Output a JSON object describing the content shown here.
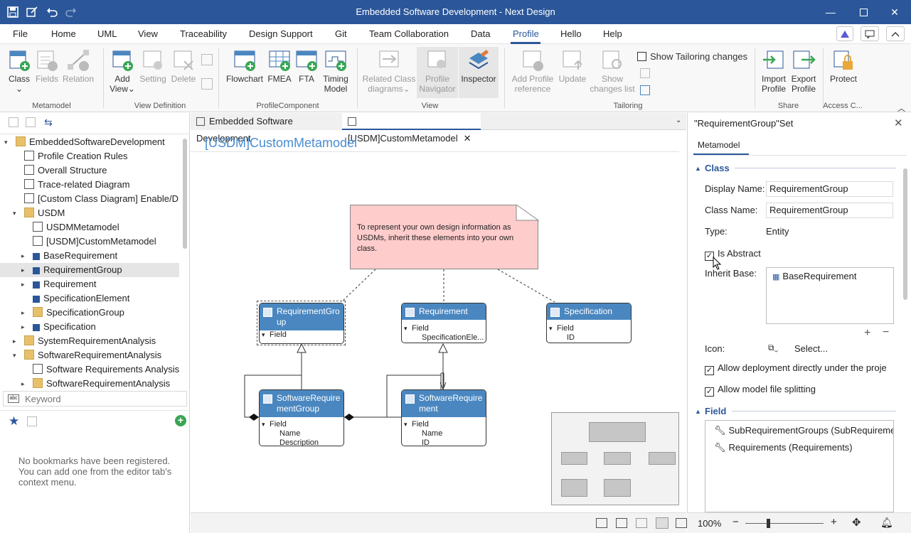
{
  "titlebar": {
    "title": "Embedded Software Development - Next Design"
  },
  "menu": [
    "File",
    "Home",
    "UML",
    "View",
    "Traceability",
    "Design Support",
    "Git",
    "Team Collaboration",
    "Data",
    "Profile",
    "Hello",
    "Help"
  ],
  "ribbon": {
    "buttons": {
      "class": "Class",
      "fields": "Fields",
      "relation": "Relation",
      "add_view_1": "Add",
      "add_view_2": "View",
      "setting": "Setting",
      "delete": "Delete",
      "flowchart": "Flowchart",
      "fmea": "FMEA",
      "fta": "FTA",
      "timing_1": "Timing",
      "timing_2": "Model",
      "related_1": "Related Class",
      "related_2": "diagrams",
      "profile_nav_1": "Profile",
      "profile_nav_2": "Navigator",
      "inspector": "Inspector",
      "add_profile_1": "Add Profile",
      "add_profile_2": "reference",
      "update": "Update",
      "show_changes_1": "Show",
      "show_changes_2": "changes list",
      "show_tailoring": "Show Tailoring changes",
      "import_1": "Import",
      "import_2": "Profile",
      "export_1": "Export",
      "export_2": "Profile",
      "protect": "Protect"
    },
    "groups": {
      "metamodel": "Metamodel",
      "view_definition": "View Definition",
      "profile_component": "ProfileComponent",
      "view": "View",
      "tailoring": "Tailoring",
      "share": "Share",
      "access": "Access C..."
    }
  },
  "tree": [
    {
      "label": "EmbeddedSoftwareDevelopment"
    },
    {
      "label": "Profile Creation Rules"
    },
    {
      "label": "Overall Structure"
    },
    {
      "label": "Trace-related Diagram"
    },
    {
      "label": "[Custom Class Diagram] Enable/D"
    },
    {
      "label": "USDM"
    },
    {
      "label": "USDMMetamodel"
    },
    {
      "label": "[USDM]CustomMetamodel"
    },
    {
      "label": "BaseRequirement"
    },
    {
      "label": "RequirementGroup"
    },
    {
      "label": "Requirement"
    },
    {
      "label": "SpecificationElement"
    },
    {
      "label": "SpecificationGroup"
    },
    {
      "label": "Specification"
    },
    {
      "label": "SystemRequirementAnalysis"
    },
    {
      "label": "SoftwareRequirementAnalysis"
    },
    {
      "label": "Software Requirements Analysis"
    },
    {
      "label": "SoftwareRequirementAnalysis"
    }
  ],
  "search": {
    "placeholder": "Keyword"
  },
  "bookmarks": {
    "empty_text": "No bookmarks have been registered. You can add one from the editor tab's context menu."
  },
  "editor": {
    "tabs": [
      "Embedded Software Development",
      "[USDM]CustomMetamodel"
    ],
    "heading": "[USDM]CustomMetamodel",
    "note": "To represent your own design information as USDMs, inherit these elements into your own class.",
    "classes": {
      "rg": {
        "title": "RequirementGro\nup",
        "field": "Field"
      },
      "req": {
        "title": "Requirement",
        "field": "Field",
        "item": "SpecificationEle..."
      },
      "spec": {
        "title": "Specification",
        "field": "Field",
        "item": "ID"
      },
      "srg": {
        "title": "SoftwareRequire\nmentGroup",
        "field": "Field",
        "item1": "Name",
        "item2": "Description"
      },
      "sr": {
        "title": "SoftwareRequire\nment",
        "field": "Field",
        "item1": "Name",
        "item2": "ID"
      }
    }
  },
  "status": {
    "zoom": "100%"
  },
  "props": {
    "title": "\"RequirementGroup\"Set",
    "tab": "Metamodel",
    "class_section": "Class",
    "display_name_label": "Display Name:",
    "display_name": "RequirementGroup",
    "class_name_label": "Class Name:",
    "class_name": "RequirementGroup",
    "type_label": "Type:",
    "type": "Entity",
    "is_abstract": "Is Abstract",
    "inherit_label": "Inherit Base:",
    "inherit_item": "BaseRequirement",
    "icon_label": "Icon:",
    "select": "Select...",
    "allow_deploy": "Allow deployment directly under the proje",
    "allow_split": "Allow model file splitting",
    "field_section": "Field",
    "fields": [
      "SubRequirementGroups (SubRequireme",
      "Requirements (Requirements)"
    ]
  },
  "colors": {
    "accent": "#2b579a",
    "class_header": "#4a87c0",
    "note_fill": "#ffcccc"
  }
}
